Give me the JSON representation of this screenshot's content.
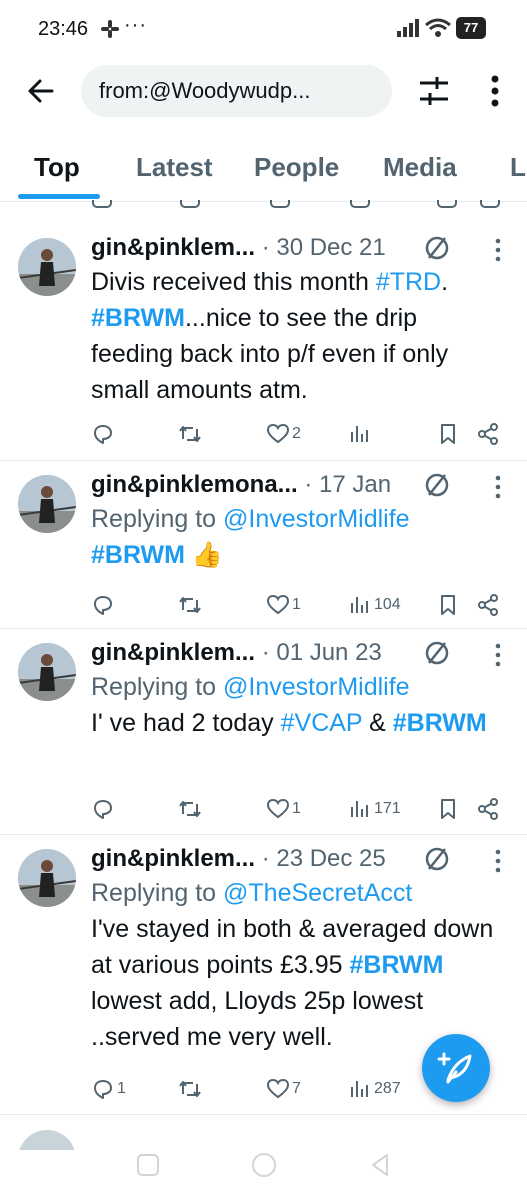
{
  "status_bar": {
    "time": "23:46",
    "more": "···",
    "battery": "77"
  },
  "search": {
    "query": "from:@Woodywudp..."
  },
  "tabs": [
    {
      "label": "Top",
      "active": true
    },
    {
      "label": "Latest",
      "active": false
    },
    {
      "label": "People",
      "active": false
    },
    {
      "label": "Media",
      "active": false
    },
    {
      "label": "Li",
      "active": false
    }
  ],
  "tweets": [
    {
      "name": "gin&pinklem...",
      "date": "· 30 Dec 21",
      "reply_prefix": "",
      "reply_handle": "",
      "body_parts": [
        {
          "t": "Divis received this month ",
          "k": "text"
        },
        {
          "t": "#TRD",
          "k": "link"
        },
        {
          "t": ". ",
          "k": "text"
        },
        {
          "t": "#BRWM",
          "k": "link-bold"
        },
        {
          "t": "...nice to see the drip feeding back into p/f even if only small amounts atm.",
          "k": "text"
        }
      ],
      "replies": "",
      "retweets": "",
      "likes": "2",
      "views": ""
    },
    {
      "name": "gin&pinklemona...",
      "date": "· 17 Jan",
      "reply_prefix": "Replying to ",
      "reply_handle": "@InvestorMidlife",
      "body_parts": [
        {
          "t": "#BRWM",
          "k": "link-bold"
        },
        {
          "t": " 👍",
          "k": "text"
        }
      ],
      "replies": "",
      "retweets": "",
      "likes": "1",
      "views": "104"
    },
    {
      "name": "gin&pinklem...",
      "date": "· 01 Jun 23",
      "reply_prefix": "Replying to ",
      "reply_handle": "@InvestorMidlife",
      "body_parts": [
        {
          "t": "I' ve had 2 today ",
          "k": "text"
        },
        {
          "t": "#VCAP",
          "k": "link"
        },
        {
          "t": " & ",
          "k": "text"
        },
        {
          "t": "#BRWM",
          "k": "link-bold"
        }
      ],
      "replies": "",
      "retweets": "",
      "likes": "1",
      "views": "171"
    },
    {
      "name": "gin&pinklem...",
      "date": "· 23 Dec 25",
      "reply_prefix": "Replying to ",
      "reply_handle": "@TheSecretAcct",
      "body_parts": [
        {
          "t": "I've stayed in both & averaged down at various points £3.95 ",
          "k": "text"
        },
        {
          "t": "#BRWM",
          "k": "link-bold"
        },
        {
          "t": " lowest add, Lloyds 25p lowest ..served me very well.",
          "k": "text"
        }
      ],
      "replies": "1",
      "retweets": "",
      "likes": "7",
      "views": "287"
    }
  ],
  "icons": {
    "back": "arrow-left-icon",
    "filter": "tune-icon",
    "menu": "more-vertical-icon",
    "fab": "compose-icon"
  },
  "colors": {
    "accent": "#1d9bf0",
    "muted": "#536471",
    "text": "#0f1419"
  }
}
